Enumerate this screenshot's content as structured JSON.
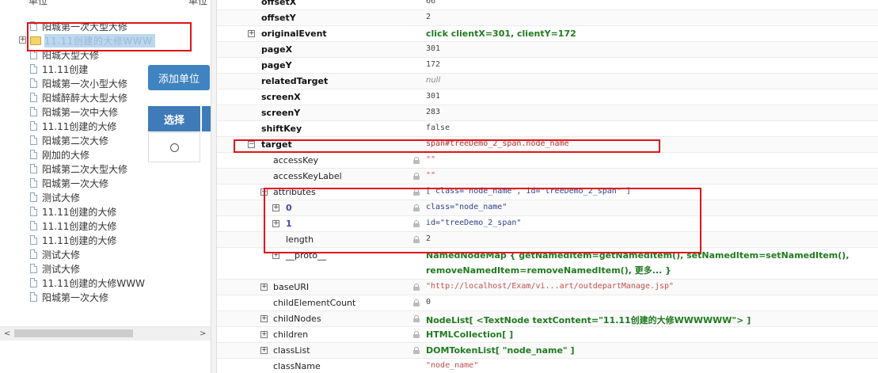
{
  "left": {
    "header_a": "单位",
    "header_b": "单位",
    "tree": [
      {
        "label": "阳城第一次大型大修"
      },
      {
        "label": "11.11创建的大修WWW",
        "selected": true
      },
      {
        "label": "阳城大型大修"
      },
      {
        "label": "11.11创建"
      },
      {
        "label": "阳城第一次小型大修"
      },
      {
        "label": "阳城醉醉大大型大修"
      },
      {
        "label": "阳城第一次中大修"
      },
      {
        "label": "11.11创建的大修"
      },
      {
        "label": "阳城第二次大修"
      },
      {
        "label": "刚加的大修"
      },
      {
        "label": "阳城第二次大型大修"
      },
      {
        "label": "阳城第一次大修"
      },
      {
        "label": "测试大修"
      },
      {
        "label": "11.11创建的大修"
      },
      {
        "label": "11.11创建的大修"
      },
      {
        "label": "11.11创建的大修"
      },
      {
        "label": "测试大修"
      },
      {
        "label": "测试大修"
      },
      {
        "label": "11.11创建的大修WWW"
      },
      {
        "label": "阳城第一次大修"
      }
    ],
    "expander_symbol": "+",
    "add_button": "添加单位",
    "table_header": "选择",
    "scroll_left": "<",
    "scroll_right": ">"
  },
  "inspector": {
    "rows": [
      {
        "key": "offsetX",
        "value": "66",
        "style": "mono",
        "keyStyle": "bold",
        "indent": 0,
        "twisty": ""
      },
      {
        "key": "offsetY",
        "value": "2",
        "style": "mono",
        "keyStyle": "bold",
        "indent": 0,
        "twisty": ""
      },
      {
        "key": "originalEvent",
        "value": "click clientX=301, clientY=172",
        "style": "green",
        "keyStyle": "bold",
        "indent": 0,
        "twisty": "+"
      },
      {
        "key": "pageX",
        "value": "301",
        "style": "mono",
        "keyStyle": "bold",
        "indent": 0,
        "twisty": ""
      },
      {
        "key": "pageY",
        "value": "172",
        "style": "mono",
        "keyStyle": "bold",
        "indent": 0,
        "twisty": ""
      },
      {
        "key": "relatedTarget",
        "value": "null",
        "style": "gray",
        "keyStyle": "bold",
        "indent": 0,
        "twisty": ""
      },
      {
        "key": "screenX",
        "value": "301",
        "style": "mono",
        "keyStyle": "bold",
        "indent": 0,
        "twisty": ""
      },
      {
        "key": "screenY",
        "value": "283",
        "style": "mono",
        "keyStyle": "bold",
        "indent": 0,
        "twisty": ""
      },
      {
        "key": "shiftKey",
        "value": "false",
        "style": "mono",
        "keyStyle": "bold",
        "indent": 0,
        "twisty": ""
      },
      {
        "key": "target",
        "value": "span#treeDemo_2_span.node_name",
        "style": "red",
        "keyStyle": "bold",
        "indent": 0,
        "twisty": "−"
      },
      {
        "key": "accessKey",
        "value": "\"\"",
        "style": "str",
        "keyStyle": "",
        "indent": 1,
        "twisty": "",
        "lock": true
      },
      {
        "key": "accessKeyLabel",
        "value": "\"\"",
        "style": "str",
        "keyStyle": "",
        "indent": 1,
        "twisty": "",
        "lock": true
      },
      {
        "key": "attributes",
        "value": "[ class=\"node_name\", id=\"treeDemo_2_span\" ]",
        "style": "mixed",
        "keyStyle": "",
        "indent": 1,
        "twisty": "+",
        "lock": true
      },
      {
        "key": "0",
        "value": "class=\"node_name\"",
        "style": "mixed",
        "keyStyle": "num",
        "indent": 2,
        "twisty": "+",
        "lock": true
      },
      {
        "key": "1",
        "value": "id=\"treeDemo_2_span\"",
        "style": "mixed",
        "keyStyle": "num",
        "indent": 2,
        "twisty": "+",
        "lock": true
      },
      {
        "key": "length",
        "value": "2",
        "style": "mono",
        "keyStyle": "",
        "indent": 2,
        "twisty": "",
        "lock": true
      },
      {
        "key": "__proto__",
        "value": "NamedNodeMap { getNamedItem=getNamedItem(), setNamedItem=setNamedItem(),",
        "value2": "removeNamedItem=removeNamedItem(), 更多... }",
        "style": "green",
        "keyStyle": "",
        "indent": 2,
        "twisty": "+",
        "lock": false,
        "tall": true
      },
      {
        "key": "baseURI",
        "value": "\"http://localhost/Exam/vi...art/outdepartManage.jsp\"",
        "style": "str",
        "keyStyle": "",
        "indent": 1,
        "twisty": "+",
        "lock": true
      },
      {
        "key": "childElementCount",
        "value": "0",
        "style": "mono",
        "keyStyle": "",
        "indent": 1,
        "twisty": "",
        "lock": true
      },
      {
        "key": "childNodes",
        "value": "NodeList[ <TextNode textContent=\"11.11创建的大修WWWWWW\"> ]",
        "style": "green",
        "keyStyle": "",
        "indent": 1,
        "twisty": "+",
        "lock": true
      },
      {
        "key": "children",
        "value": "HTMLCollection[ ]",
        "style": "green",
        "keyStyle": "",
        "indent": 1,
        "twisty": "+",
        "lock": true
      },
      {
        "key": "classList",
        "value": "DOMTokenList[ \"node_name\" ]",
        "style": "green",
        "keyStyle": "",
        "indent": 1,
        "twisty": "+",
        "lock": true
      },
      {
        "key": "className",
        "value": "\"node_name\"",
        "style": "str",
        "keyStyle": "",
        "indent": 1,
        "twisty": "",
        "lock": false
      }
    ]
  },
  "colors": {
    "highlight": "#e0131a",
    "button": "#3f83c1",
    "selection": "#bcd7ee"
  }
}
